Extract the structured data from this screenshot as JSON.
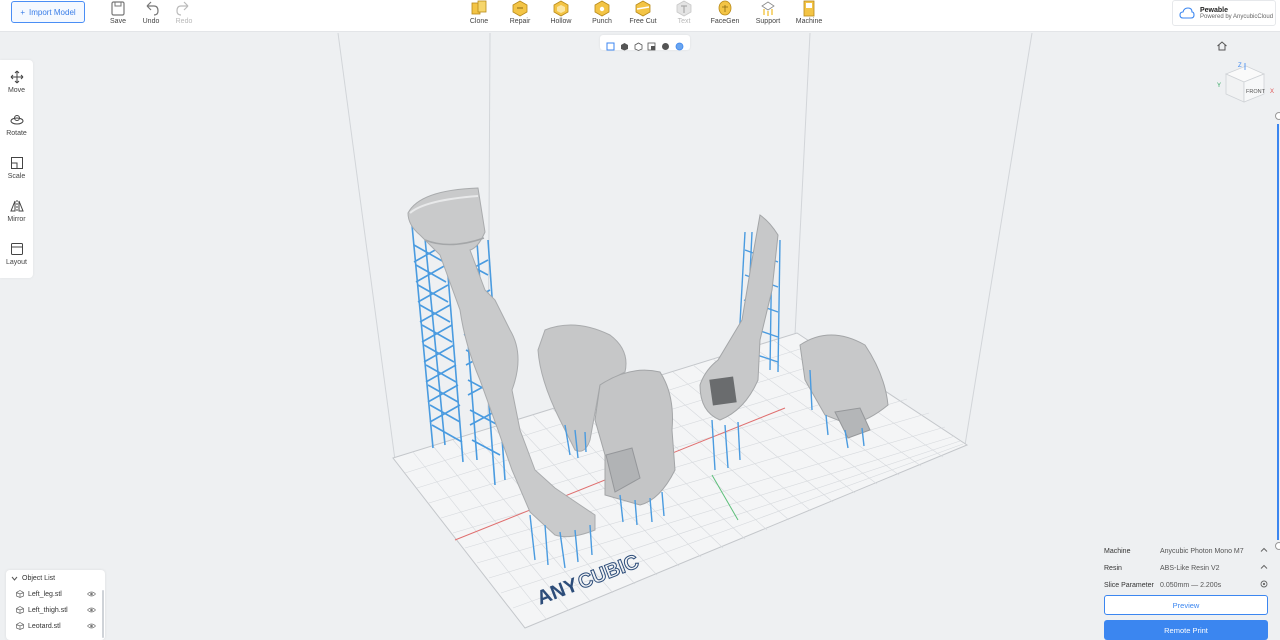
{
  "toolbar": {
    "import_label": "Import Model",
    "save_label": "Save",
    "undo_label": "Undo",
    "redo_label": "Redo",
    "tools": [
      {
        "label": "Clone",
        "icon": "clone-icon"
      },
      {
        "label": "Repair",
        "icon": "repair-icon"
      },
      {
        "label": "Hollow",
        "icon": "hollow-icon"
      },
      {
        "label": "Punch",
        "icon": "punch-icon"
      },
      {
        "label": "Free Cut",
        "icon": "free-cut-icon"
      },
      {
        "label": "Text",
        "icon": "text-icon"
      },
      {
        "label": "FaceGen",
        "icon": "facegen-icon"
      },
      {
        "label": "Support",
        "icon": "support-icon"
      },
      {
        "label": "Machine",
        "icon": "machine-icon"
      }
    ]
  },
  "cloud": {
    "title": "Pewable",
    "subtitle": "Powered by AnycubicCloud"
  },
  "sidebar": {
    "items": [
      {
        "label": "Move",
        "icon": "move-icon"
      },
      {
        "label": "Rotate",
        "icon": "rotate-icon"
      },
      {
        "label": "Scale",
        "icon": "scale-icon"
      },
      {
        "label": "Mirror",
        "icon": "mirror-icon"
      },
      {
        "label": "Layout",
        "icon": "layout-icon"
      }
    ]
  },
  "viewcube": {
    "face_label": "FRONT",
    "axis_z": "Z",
    "axis_y": "Y",
    "axis_x": "X"
  },
  "build_plate": {
    "brand_text_1": "ANY",
    "brand_text_2": "CUBIC"
  },
  "object_list": {
    "title": "Object List",
    "items": [
      {
        "name": "Left_leg.stl"
      },
      {
        "name": "Left_thigh.stl"
      },
      {
        "name": "Leotard.stl"
      }
    ]
  },
  "machine_panel": {
    "machine_key": "Machine",
    "machine_value": "Anycubic Photon Mono M7",
    "resin_key": "Resin",
    "resin_value": "ABS-Like Resin V2",
    "slice_key": "Slice Parameter",
    "slice_value": "0.050mm — 2.200s",
    "preview_label": "Preview",
    "print_label": "Remote Print"
  },
  "colors": {
    "accent": "#3b86f0",
    "support": "#4a9be0",
    "model": "#c9cacb"
  }
}
